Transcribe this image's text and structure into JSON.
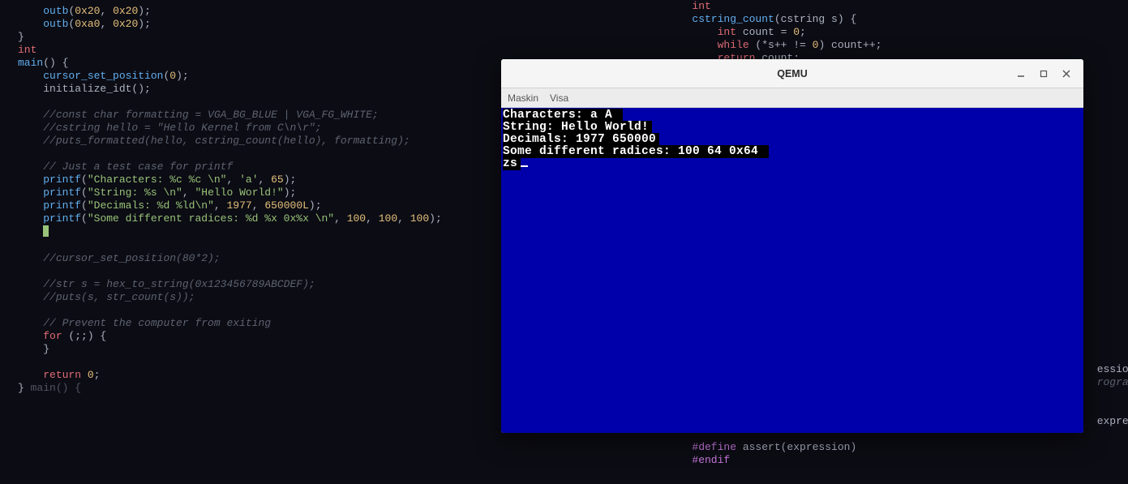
{
  "editor_left": {
    "l1a": "outb",
    "l1b": "0x20",
    "l1c": "0x20",
    "l2a": "outb",
    "l2b": "0xa0",
    "l2c": "0x20",
    "l3": "}",
    "l4": "int",
    "l5a": "main",
    "l5b": "() {",
    "l6a": "cursor_set_position",
    "l6b": "0",
    "l7": "initialize_idt();",
    "c1": "//const char formatting = VGA_BG_BLUE | VGA_FG_WHITE;",
    "c2": "//cstring hello = \"Hello Kernel from C\\n\\r\";",
    "c3": "//puts_formatted(hello, cstring_count(hello), formatting);",
    "c4": "// Just a test case for printf",
    "p1f": "printf",
    "p1s": "\"Characters: %c %c \\n\"",
    "p1a": "'a'",
    "p1b": "65",
    "p2f": "printf",
    "p2s": "\"String: %s \\n\"",
    "p2a": "\"Hello World!\"",
    "p3f": "printf",
    "p3s": "\"Decimals: %d %ld\\n\"",
    "p3a": "1977",
    "p3b": "650000L",
    "p4f": "printf",
    "p4s": "\"Some different radices: %d %x 0x%x \\n\"",
    "p4a": "100",
    "p4b": "100",
    "p4c": "100",
    "c5": "//cursor_set_position(80*2);",
    "c6": "//str s = hex_to_string(0x123456789ABCDEF);",
    "c7": "//puts(s, str_count(s));",
    "c8": "// Prevent the computer from exiting",
    "for_kw": "for",
    "for_body": " (;;) {",
    "rbrace": "}",
    "ret_kw": "return",
    "ret_v": "0",
    "close": "}",
    "close_annot": " main() {"
  },
  "editor_right": {
    "r0": "int",
    "r1a": "cstring_count",
    "r1b": "(cstring s) {",
    "r2a": "int",
    "r2b": " count = ",
    "r2c": "0",
    "r2d": ";",
    "r3a": "while",
    "r3b": " (*s++ != ",
    "r3c": "0",
    "r3d": ") count++;",
    "r4a": "return",
    "r4b": " count;",
    "t1": "ession);",
    "t2a": "rogram",
    "t3": "express",
    "m1a": "#define",
    "m1b": " assert(expression)",
    "m2": "#endif"
  },
  "qemu": {
    "title": "QEMU",
    "menu1": "Maskin",
    "menu2": "Visa",
    "vga": {
      "l1": "Characters: a A ",
      "l2": "String: Hello World!",
      "l3": "Decimals: 1977 650000",
      "l4": "Some different radices: 100 64 0x64 ",
      "l5": "zs"
    }
  }
}
